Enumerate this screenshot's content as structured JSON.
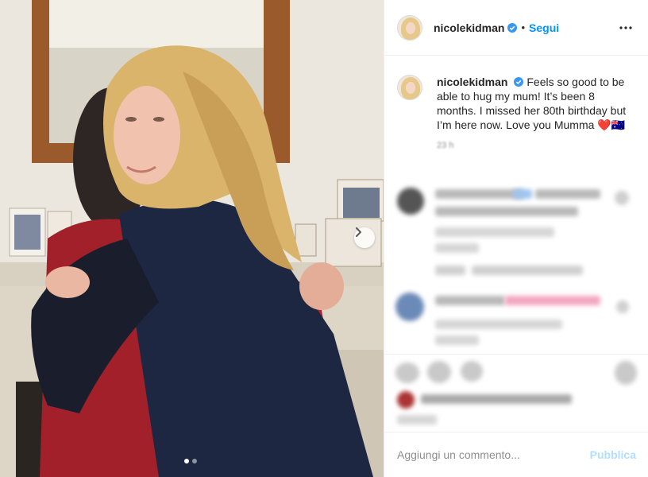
{
  "post": {
    "username": "nicolekidman",
    "follow_label": "Segui",
    "separator": "•",
    "caption": "Feels so good to be able to hug my mum! It’s been 8 months. I missed her 80th birthday but I’m here now. Love you Mumma",
    "emoji": "❤️🇦🇺",
    "timestamp": "23 h",
    "carousel_slides": 2,
    "carousel_active": 1
  },
  "comment_box": {
    "placeholder": "Aggiungi un commento...",
    "publish_label": "Pubblica"
  },
  "colors": {
    "accent": "#0095f6",
    "publish_disabled": "#b2dffc",
    "verified": "#3897f0"
  },
  "icons": [
    "verified-badge-icon",
    "more-options-icon",
    "chevron-right-icon"
  ]
}
